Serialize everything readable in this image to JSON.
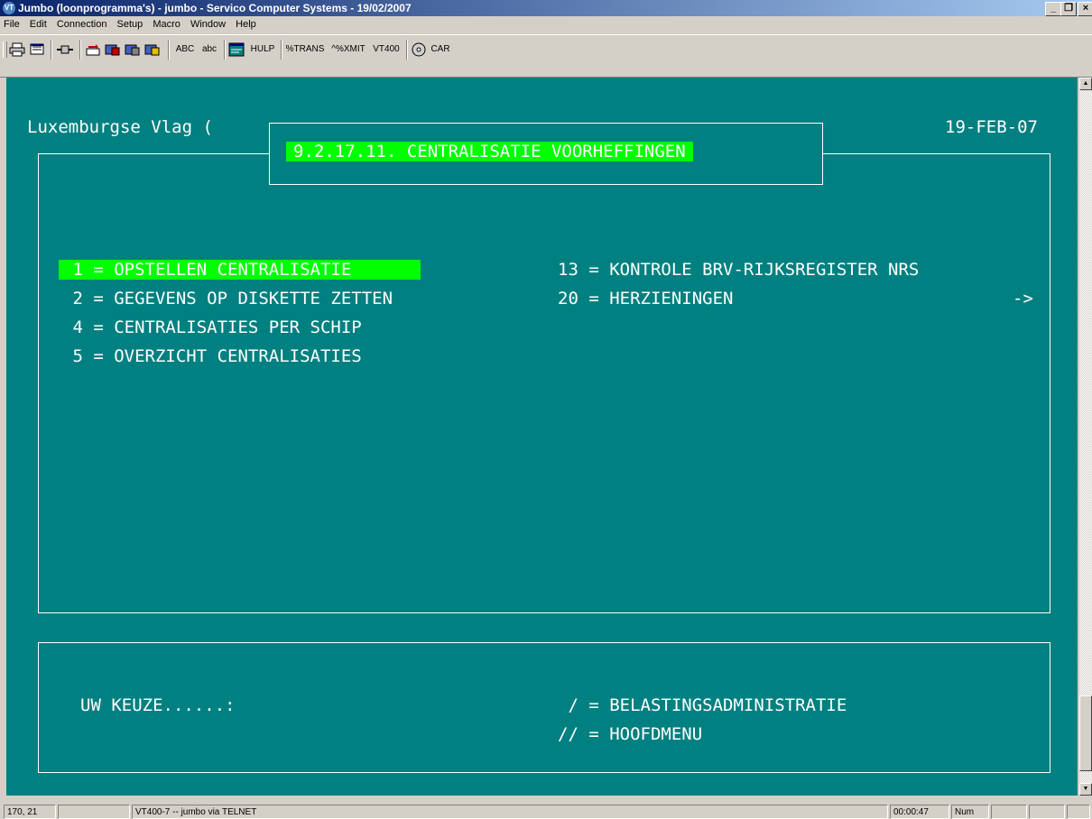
{
  "window": {
    "title": "Jumbo (loonprogramma's) - jumbo - Servico Computer Systems - 19/02/2007",
    "icon_label": "VT",
    "controls": [
      "minimize-icon",
      "restore-icon",
      "close-icon"
    ]
  },
  "menu": {
    "items": [
      "File",
      "Edit",
      "Connection",
      "Setup",
      "Macro",
      "Window",
      "Help"
    ]
  },
  "toolbar": {
    "icons": [
      "printer-icon",
      "print-setup-icon",
      "connect-icon",
      "send-file-icon",
      "capture-icon",
      "receive-icon",
      "transfer-icon"
    ],
    "abc_upper": "ABC",
    "abc_lower": "abc",
    "hulp_label": "HULP",
    "trans_label": "%TRANS",
    "xmit_label": "^%XMIT",
    "vt400_label": "VT400",
    "car_label": "CAR"
  },
  "screen": {
    "company": "Luxemburgse Vlag (",
    "date": "19-FEB-07",
    "title": "9.2.17.11. CENTRALISATIE VOORHEFFINGEN",
    "options_left": [
      " 1 = OPSTELLEN CENTRALISATIE      ",
      " 2 = GEGEVENS OP DISKETTE ZETTEN",
      " 4 = CENTRALISATIES PER SCHIP",
      " 5 = OVERZICHT CENTRALISATIES"
    ],
    "options_right": [
      "13 = KONTROLE BRV-RIJKSREGISTER NRS",
      "20 = HERZIENINGEN"
    ],
    "more_arrow": "->",
    "prompt": "UW KEUZE......:",
    "shortcuts": [
      " / = BELASTINGSADMINISTRATIE",
      "// = HOOFDMENU"
    ]
  },
  "status": {
    "cursor": "170, 21",
    "connection": "VT400-7 -- jumbo via TELNET",
    "timer": "00:00:47",
    "num": "Num"
  },
  "colors": {
    "terminal_bg": "#008080",
    "highlight": "#00ff00",
    "titlebar": "#0a246a"
  }
}
